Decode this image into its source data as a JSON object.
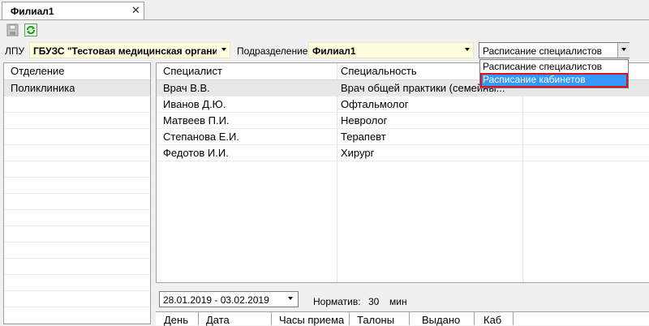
{
  "tab": {
    "label": "Филиал1",
    "close_glyph": "✕"
  },
  "toolbar": {
    "save_icon": "save-icon",
    "refresh_icon": "refresh-icon"
  },
  "filters": {
    "lpu_label": "ЛПУ",
    "lpu_value": "ГБУЗС \"Тестовая медицинская органи",
    "subdivision_label": "Подразделение",
    "subdivision_value": "Филиал1",
    "view_value": "Расписание специалистов",
    "highlight_color": "#ffffe0"
  },
  "view_dropdown": {
    "options": [
      "Расписание специалистов",
      "Расписание кабинетов"
    ],
    "hovered_index": 1,
    "selection_color": "#3399ff",
    "highlight_border_color": "#d9141e"
  },
  "departments": {
    "header": "Отделение",
    "items": [
      "Поликлиника"
    ]
  },
  "specialists": {
    "columns": [
      "Специалист",
      "Специальность"
    ],
    "rows": [
      {
        "name": "Врач В.В.",
        "specialty": "Врач общей практики (семейны..."
      },
      {
        "name": "Иванов Д.Ю.",
        "specialty": "Офтальмолог"
      },
      {
        "name": "Матвеев П.И.",
        "specialty": "Невролог"
      },
      {
        "name": "Степанова Е.И.",
        "specialty": "Терапевт"
      },
      {
        "name": "Федотов И.И.",
        "specialty": "Хирург"
      }
    ]
  },
  "period": {
    "date_range": "28.01.2019 - 03.02.2019",
    "norm_label": "Норматив:",
    "norm_value": "30",
    "norm_unit": "мин"
  },
  "schedule": {
    "columns": [
      "День",
      "Дата",
      "Часы приема",
      "Талоны",
      "Выдано",
      "Каб"
    ]
  }
}
